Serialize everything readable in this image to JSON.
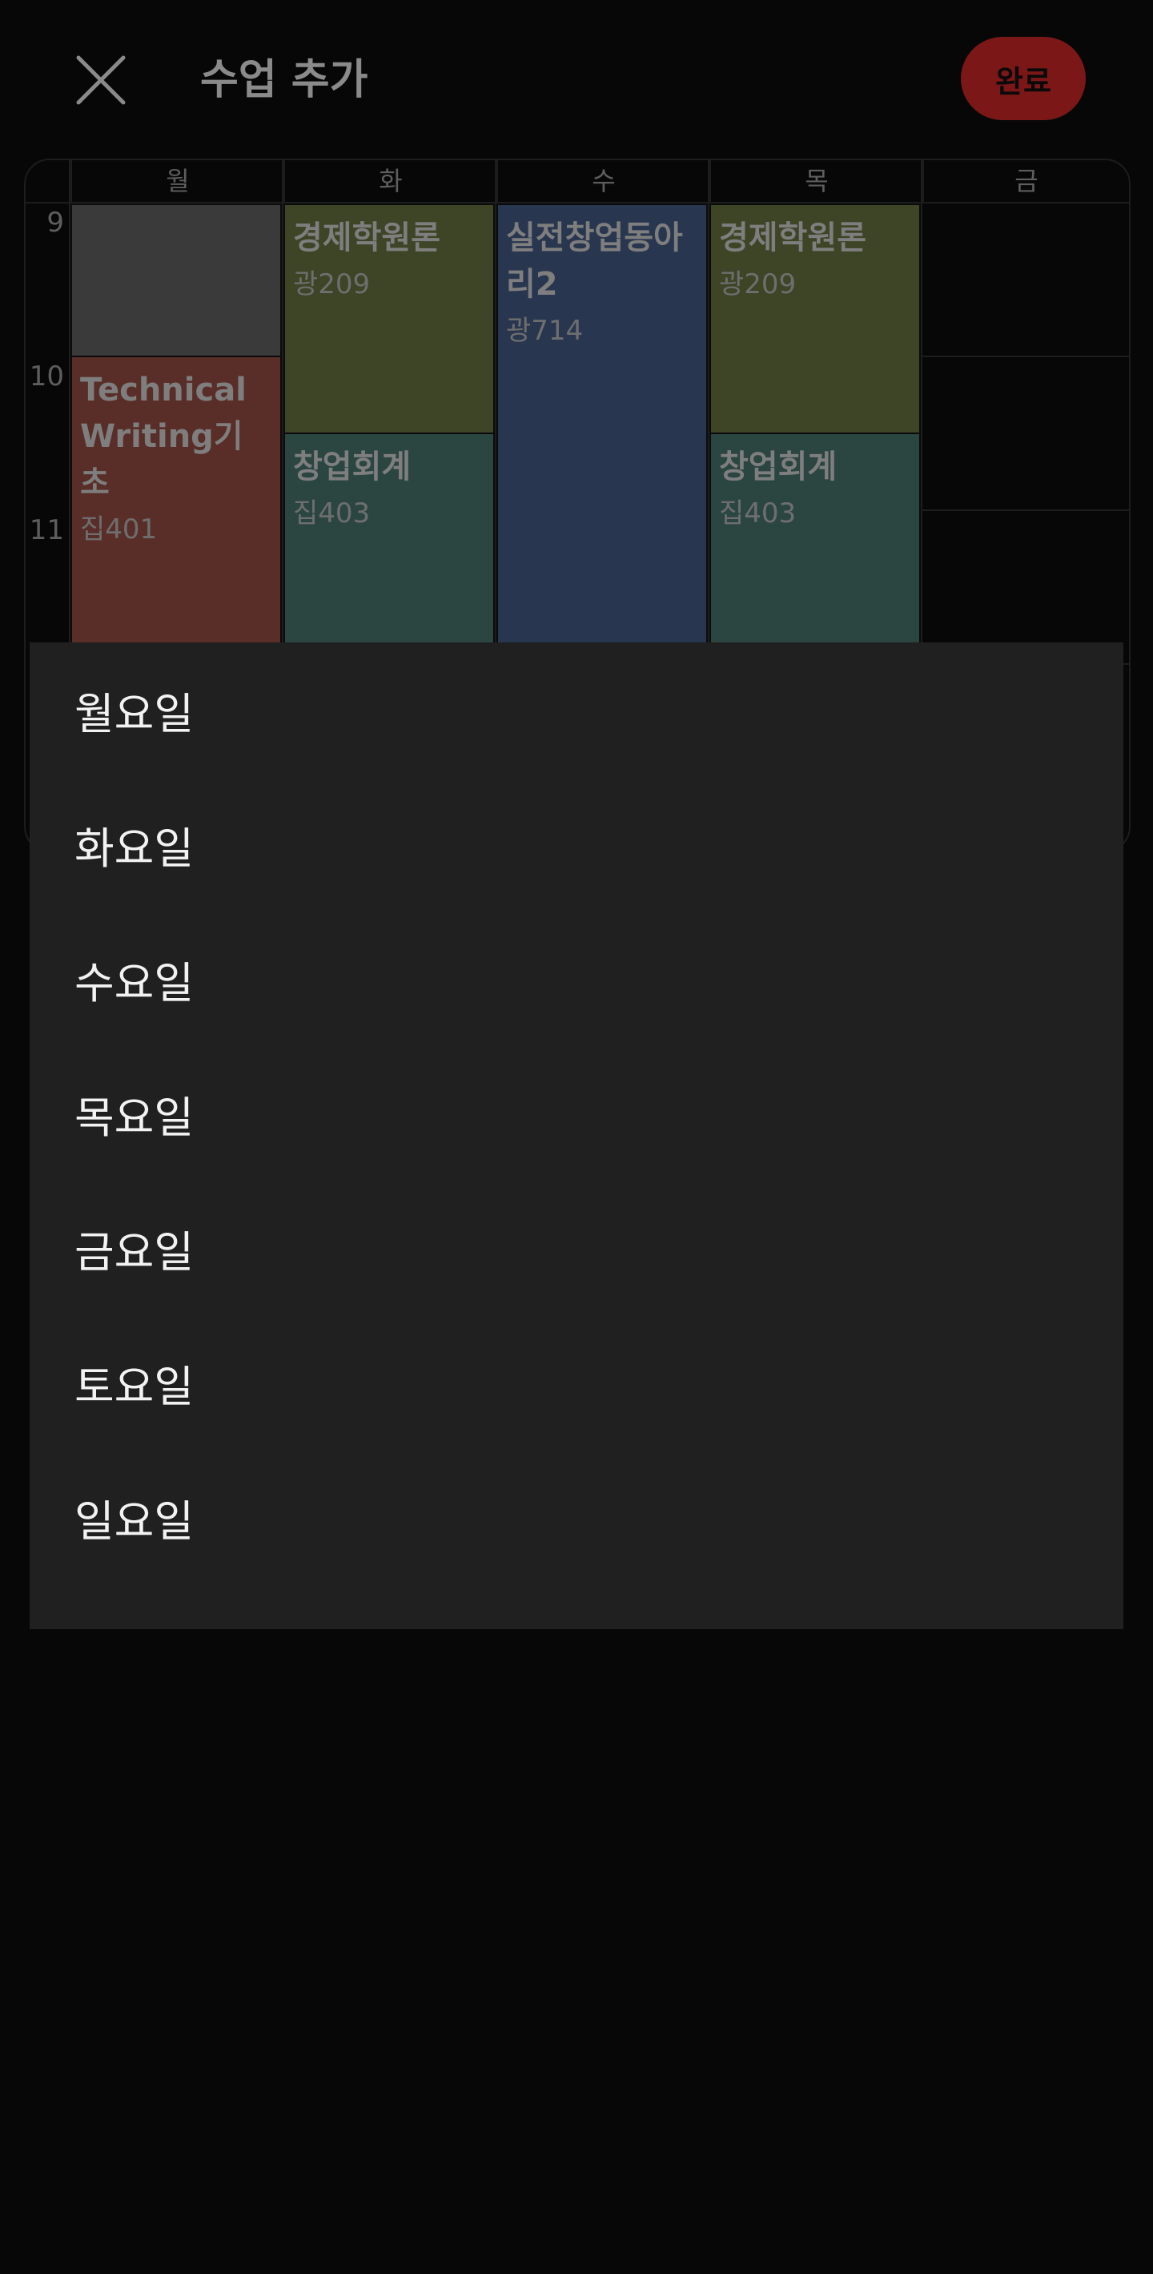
{
  "header": {
    "close_icon": "close-icon",
    "title": "수업 추가",
    "done_label": "완료",
    "accent_color": "#7c1717"
  },
  "timetable": {
    "days": [
      "월",
      "화",
      "수",
      "목",
      "금"
    ],
    "hours": [
      "9",
      "10",
      "11"
    ],
    "blocks": [
      {
        "title": "",
        "room": "",
        "color": "#3a3a3a"
      },
      {
        "title": "Technical Writing기초",
        "room": "집401",
        "color": "#5a2e28"
      },
      {
        "title": "경제학원론",
        "room": "광209",
        "color": "#3e4426"
      },
      {
        "title": "창업회계",
        "room": "집403",
        "color": "#2b4640"
      },
      {
        "title": "실전창업동아리2",
        "room": "광714",
        "color": "#29364f"
      },
      {
        "title": "경제학원론",
        "room": "광209",
        "color": "#3e4426"
      },
      {
        "title": "창업회계",
        "room": "집403",
        "color": "#2b4640"
      }
    ]
  },
  "day_menu": {
    "items": [
      "월요일",
      "화요일",
      "수요일",
      "목요일",
      "금요일",
      "토요일",
      "일요일"
    ]
  }
}
